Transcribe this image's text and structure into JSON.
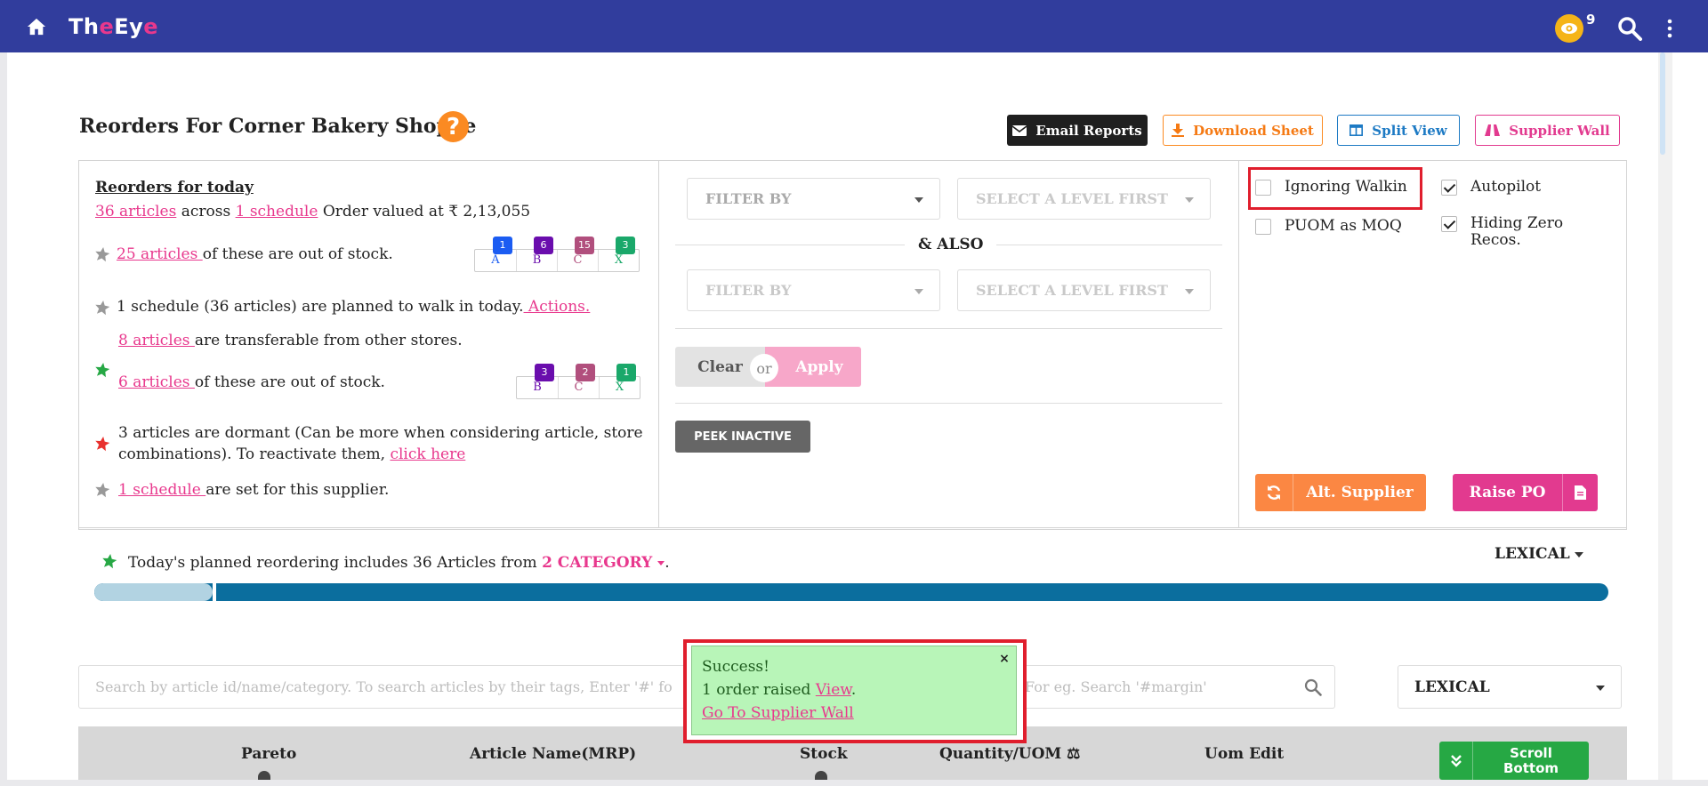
{
  "app": {
    "brand_a": "Th",
    "brand_b": "e",
    "brand_c": "Ey",
    "brand_d": "e",
    "notification_count": "9"
  },
  "header": {
    "title": "Reorders For Corner Bakery Shoppe",
    "help": "?",
    "email_reports": "Email Reports",
    "download_sheet": "Download Sheet",
    "split_view": "Split View",
    "supplier_wall": "Supplier Wall"
  },
  "summary": {
    "heading": "Reorders for today",
    "line1_articles": "36 articles",
    "line1_across": "across",
    "line1_schedule": "1 schedule",
    "line1_value": "Order valued at ₹ 2,13,055",
    "oos_link": "25 articles ",
    "oos_text": "of these are out of stock.",
    "oos_tags": [
      {
        "label": "A",
        "count": "1",
        "color": "#1b5cf2"
      },
      {
        "label": "B",
        "count": "6",
        "color": "#6a0dad"
      },
      {
        "label": "C",
        "count": "15",
        "color": "#b14f7d"
      },
      {
        "label": "X",
        "count": "3",
        "color": "#1aa86a"
      }
    ],
    "walkin_text": "1 schedule (36 articles) are planned to walk in today.",
    "walkin_link": " Actions.",
    "transfer_link": "8 articles ",
    "transfer_text": "are transferable from other stores.",
    "oos2_link": "6 articles ",
    "oos2_text": "of these are out of stock.",
    "oos2_tags": [
      {
        "label": "B",
        "count": "3",
        "color": "#6a0dad"
      },
      {
        "label": "C",
        "count": "2",
        "color": "#b14f7d"
      },
      {
        "label": "X",
        "count": "1",
        "color": "#1aa86a"
      }
    ],
    "dormant_line1": "3 articles are dormant (Can be more when considering article, store",
    "dormant_line2": "combinations). To reactivate them, ",
    "dormant_link": "click here",
    "schedule_link": "1 schedule ",
    "schedule_text": "are set for this supplier."
  },
  "filters": {
    "filter_by_1": "FILTER BY",
    "level_1": "SELECT A LEVEL FIRST",
    "also": "& ALSO",
    "filter_by_2": "FILTER BY",
    "level_2": "SELECT A LEVEL FIRST",
    "clear": "Clear",
    "or": "or",
    "apply": "Apply",
    "peek_inactive": "PEEK INACTIVE"
  },
  "options": {
    "ignoring_walkin": "Ignoring Walkin",
    "autopilot": "Autopilot",
    "puom_as_moq": "PUOM as MOQ",
    "hiding_zero_1": "Hiding Zero",
    "hiding_zero_2": "Recos.",
    "alt_supplier": "Alt. Supplier",
    "raise_po": "Raise PO"
  },
  "planned": {
    "text": "Today's planned reordering includes 36 Articles from",
    "category": "2 CATEGORY",
    "period": ".",
    "sort": "LEXICAL",
    "progress_fraction": 0.078
  },
  "search": {
    "placeholder_head": "Search by article id/name/category. To search articles by their tags, Enter '#' fo",
    "placeholder_tail": "For eg. Search '#margin'",
    "sort_value": "LEXICAL"
  },
  "table": {
    "pareto": "Pareto",
    "article_name": "Article Name(MRP)",
    "stock": "Stock",
    "quantity": "Quantity/UOM ⚖",
    "uom_edit": "Uom Edit",
    "scroll_bottom_1": "Scroll",
    "scroll_bottom_2": "Bottom"
  },
  "toast": {
    "title": "Success!",
    "line2_text": "1 order raised ",
    "line2_link": "View",
    "line2_end": ".",
    "line3_link": "Go To Supplier Wall",
    "close": "×"
  }
}
